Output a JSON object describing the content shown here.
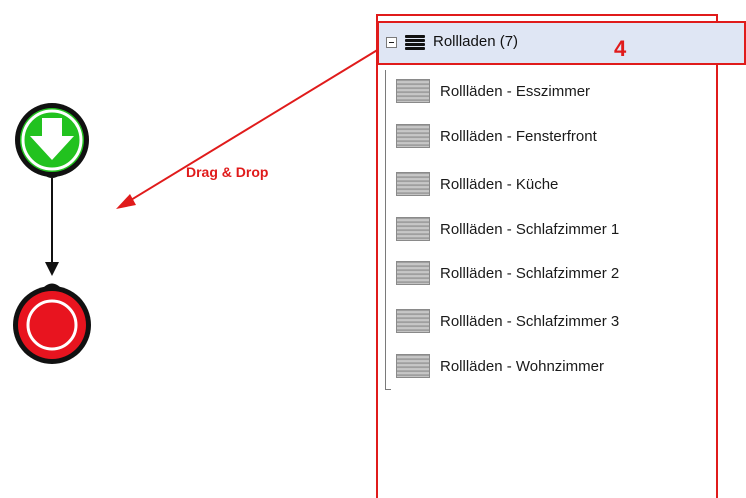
{
  "annotation": {
    "drag_drop_label": "Drag & Drop",
    "badge_number": "4",
    "highlight_color": "#e01b1b"
  },
  "flow": {
    "start_node_icon": "down-arrow-icon",
    "end_node_icon": "stop-circle-icon",
    "start_color": "#22c21f",
    "end_color": "#e8141f"
  },
  "tree": {
    "group": {
      "label": "Rollladen (7)",
      "icon": "blinds-group-icon",
      "expanded": true
    },
    "items": [
      {
        "label": "Rollläden - Esszimmer",
        "icon": "shutter-icon"
      },
      {
        "label": "Rollläden - Fensterfront",
        "icon": "shutter-icon"
      },
      {
        "label": "Rollläden - Küche",
        "icon": "shutter-icon"
      },
      {
        "label": "Rollläden - Schlafzimmer 1",
        "icon": "shutter-icon"
      },
      {
        "label": "Rollläden - Schlafzimmer 2",
        "icon": "shutter-icon"
      },
      {
        "label": "Rollläden - Schlafzimmer 3",
        "icon": "shutter-icon"
      },
      {
        "label": "Rollläden - Wohnzimmer",
        "icon": "shutter-icon"
      }
    ]
  }
}
